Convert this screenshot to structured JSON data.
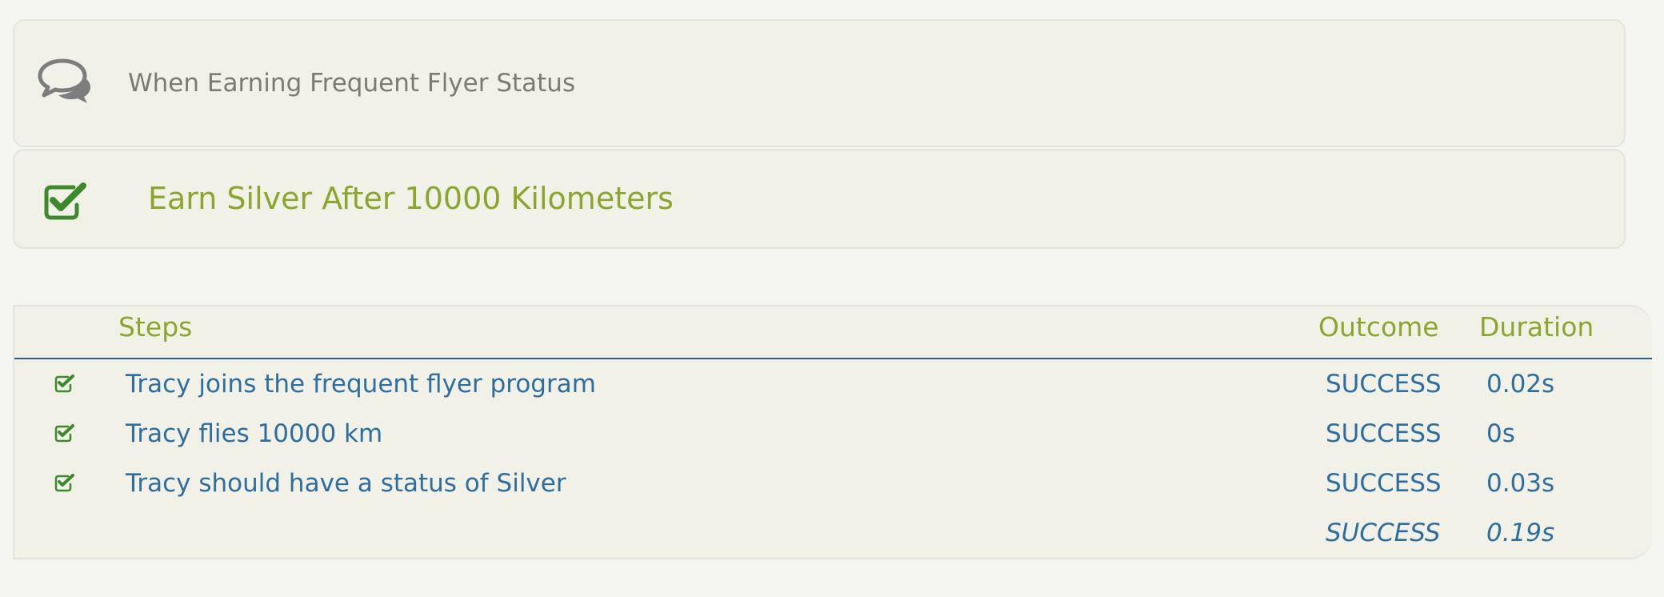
{
  "story": {
    "icon": "comments-icon",
    "title": "When Earning Frequent Flyer Status"
  },
  "scenario": {
    "icon": "checked-checkbox-icon",
    "title": "Earn Silver After 10000 Kilometers"
  },
  "steps_table": {
    "headers": {
      "steps": "Steps",
      "outcome": "Outcome",
      "duration": "Duration"
    },
    "rows": [
      {
        "icon": "checked-checkbox-icon",
        "description": "Tracy joins the frequent flyer program",
        "outcome": "SUCCESS",
        "duration": "0.02s"
      },
      {
        "icon": "checked-checkbox-icon",
        "description": "Tracy flies 10000 km",
        "outcome": "SUCCESS",
        "duration": "0s"
      },
      {
        "icon": "checked-checkbox-icon",
        "description": "Tracy should have a status of Silver",
        "outcome": "SUCCESS",
        "duration": "0.03s"
      }
    ],
    "total": {
      "outcome": "SUCCESS",
      "duration": "0.19s"
    }
  },
  "colors": {
    "page_background": "#f6f6f1",
    "panel_background": "#f1f1e8",
    "accent_green": "#8ba62e",
    "check_green": "#3d8a2c",
    "link_blue": "#2e6e9e",
    "muted_gray": "#7b7b74"
  }
}
